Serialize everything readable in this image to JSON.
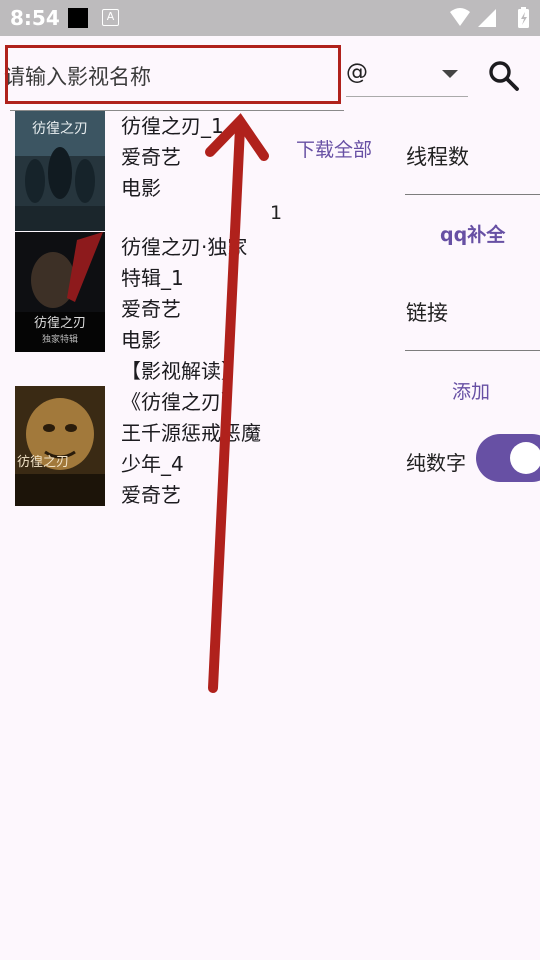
{
  "status_bar": {
    "time": "8:54",
    "a_icon_letter": "A"
  },
  "search": {
    "placeholder": "请输入影视名称",
    "value": ""
  },
  "dropdown": {
    "selected": "@"
  },
  "results": [
    {
      "poster_title": "彷徨之刃",
      "lines": [
        "彷徨之刃_1",
        "爱奇艺",
        "电影"
      ]
    },
    {
      "poster_title": "彷徨之刃",
      "poster_subtitle": "独家特辑",
      "lines": [
        "彷徨之刃·独家",
        "特辑_1",
        "爱奇艺",
        "电影"
      ]
    },
    {
      "poster_title": "彷徨之刃",
      "lines": [
        "【影视解读】",
        "《彷徨之刃》",
        "王千源惩戒恶魔",
        "少年_4",
        "爱奇艺"
      ]
    }
  ],
  "actions": {
    "download_all": "下载全部",
    "count": "1"
  },
  "side_panel": {
    "threads_label": "线程数",
    "qq_complete": "qq补全",
    "link_label": "链接",
    "add": "添加",
    "numbers_only_label": "纯数字",
    "numbers_only_on": true
  },
  "colors": {
    "accent": "#6750a4",
    "annotation": "#b0211c"
  }
}
